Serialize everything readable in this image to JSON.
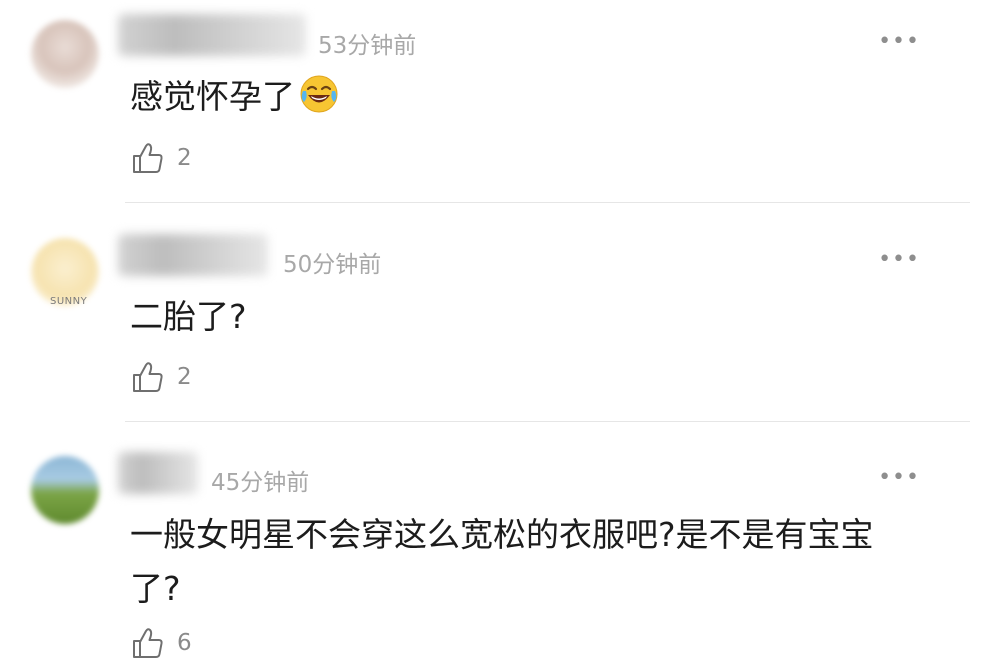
{
  "comments": [
    {
      "time": "53分钟前",
      "text": "感觉怀孕了",
      "emoji": "tears-of-joy",
      "likes": "2",
      "more_label": "•••"
    },
    {
      "avatar_caption": "SUNNY",
      "time": "50分钟前",
      "text": "二胎了?",
      "likes": "2",
      "more_label": "•••"
    },
    {
      "time": "45分钟前",
      "text": "一般女明星不会穿这么宽松的衣服吧?是不是有宝宝了?",
      "likes": "6",
      "more_label": "•••"
    }
  ],
  "colors": {
    "text": "#1c1c1c",
    "time": "#a8a8a8",
    "icon": "#6f6f6f",
    "divider": "#e6e6e6"
  }
}
